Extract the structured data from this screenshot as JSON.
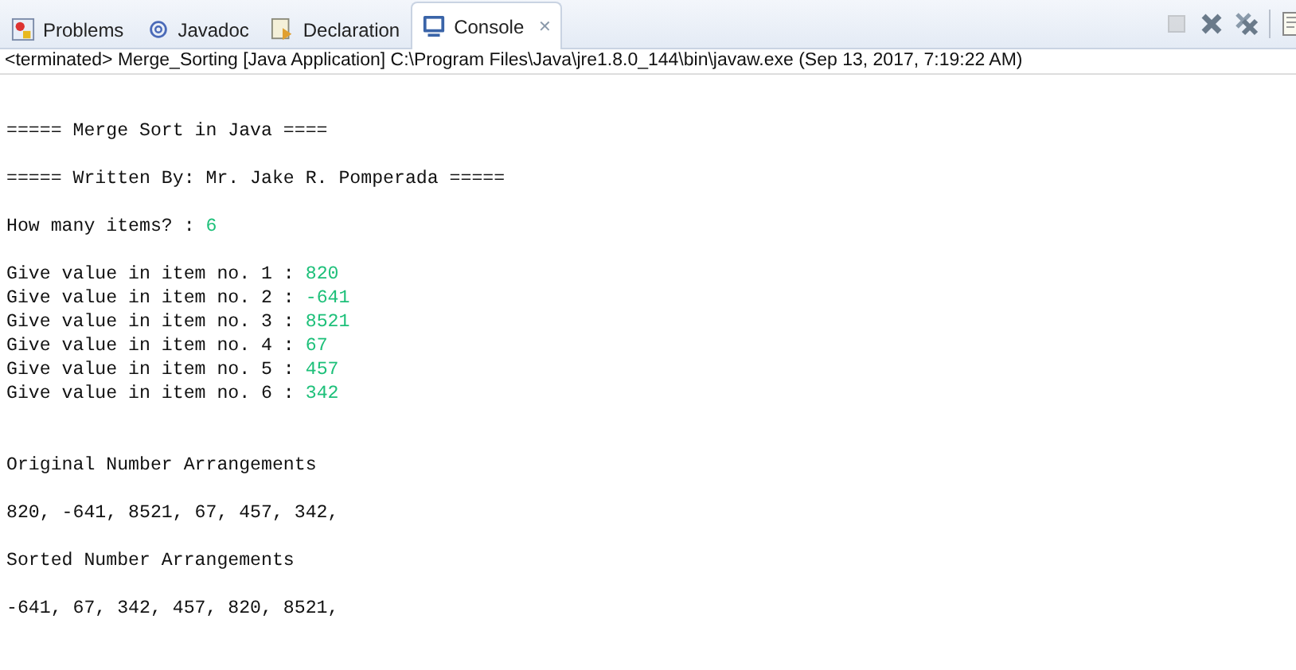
{
  "tabs": [
    {
      "label": "Problems",
      "selected": false,
      "kind": "problems"
    },
    {
      "label": "Javadoc",
      "selected": false,
      "kind": "javadoc"
    },
    {
      "label": "Declaration",
      "selected": false,
      "kind": "declaration"
    },
    {
      "label": "Console",
      "selected": true,
      "kind": "console",
      "close": "✕"
    }
  ],
  "toolbar": [
    {
      "kind": "terminate",
      "disabled": true
    },
    {
      "kind": "remove"
    },
    {
      "kind": "remove-all"
    },
    {
      "kind": "separator"
    },
    {
      "kind": "document"
    }
  ],
  "status": "<terminated> Merge_Sorting [Java Application] C:\\Program Files\\Java\\jre1.8.0_144\\bin\\javaw.exe (Sep 13, 2017, 7:19:22 AM)",
  "console_blocks": [
    {
      "kind": "section",
      "lines": [
        {
          "text": "===== Merge Sort in Java ===="
        }
      ]
    },
    {
      "kind": "paragraph",
      "lines": [
        {
          "text": "===== Written By: Mr. Jake R. Pomperada ====="
        }
      ]
    },
    {
      "kind": "paragraph",
      "lines": [
        {
          "text": "How many items? : ",
          "input": "6"
        }
      ]
    },
    {
      "kind": "paragraph",
      "lines": [
        {
          "text": "Give value in item no. 1 : ",
          "input": "820"
        },
        {
          "text": "Give value in item no. 2 : ",
          "input": "-641"
        },
        {
          "text": "Give value in item no. 3 : ",
          "input": "8521"
        },
        {
          "text": "Give value in item no. 4 : ",
          "input": "67"
        },
        {
          "text": "Give value in item no. 5 : ",
          "input": "457"
        },
        {
          "text": "Give value in item no. 6 : ",
          "input": "342"
        }
      ]
    },
    {
      "kind": "section",
      "lines": [
        {
          "text": "Original Number Arrangements"
        }
      ]
    },
    {
      "kind": "paragraph",
      "lines": [
        {
          "text": "820, -641, 8521, 67, 457, 342,"
        }
      ]
    },
    {
      "kind": "paragraph",
      "lines": [
        {
          "text": "Sorted Number Arrangements"
        }
      ]
    },
    {
      "kind": "paragraph",
      "lines": [
        {
          "text": "-641, 67, 342, 457, 820, 8521,"
        }
      ]
    }
  ]
}
